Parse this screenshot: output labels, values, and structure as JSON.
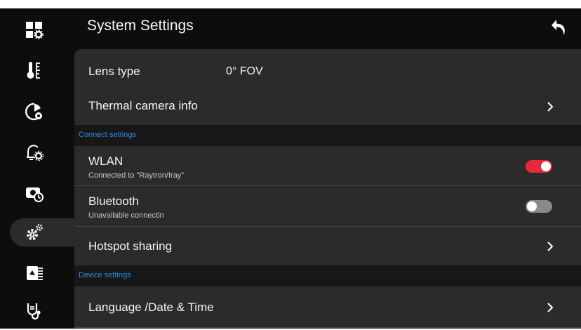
{
  "header": {
    "title": "System Settings",
    "back_icon": "back-arrow-icon"
  },
  "sidebar": {
    "items": [
      {
        "icon": "dashboard-settings-icon",
        "active": false
      },
      {
        "icon": "thermometer-icon",
        "active": false
      },
      {
        "icon": "palette-settings-icon",
        "active": false
      },
      {
        "icon": "alarm-settings-icon",
        "active": false
      },
      {
        "icon": "camera-timer-icon",
        "active": false
      },
      {
        "icon": "gears-icon",
        "active": true
      },
      {
        "icon": "image-fusion-icon",
        "active": false
      },
      {
        "icon": "stethoscope-icon",
        "active": false
      }
    ]
  },
  "rows": {
    "lens": {
      "label": "Lens type",
      "value": "0° FOV"
    },
    "thermal_info": {
      "label": "Thermal camera info"
    },
    "wlan": {
      "label": "WLAN",
      "sub": "Connected to \"Raytron/Iray\"",
      "enabled": true
    },
    "bluetooth": {
      "label": "Bluetooth",
      "sub": "Unavailable connectin",
      "enabled": false
    },
    "hotspot": {
      "label": "Hotspot sharing"
    },
    "language": {
      "label": "Language /Date & Time"
    }
  },
  "sections": {
    "connect": "Connect settings",
    "device": "Device settings"
  },
  "colors": {
    "accent": "#2f8de4",
    "toggle_on": "#e8293b",
    "toggle_off": "#8a8a8a"
  }
}
